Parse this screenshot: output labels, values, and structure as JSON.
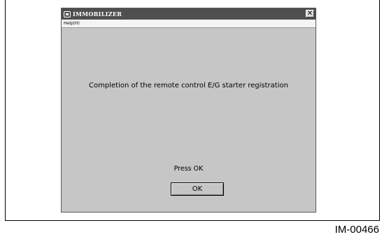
{
  "window": {
    "title": "IMMOBILIZER",
    "close_glyph": "✕",
    "menu": {
      "help_label": "Help(H)"
    }
  },
  "dialog": {
    "message": "Completion of the remote control E/G starter registration",
    "prompt": "Press OK",
    "ok_label": "OK"
  },
  "figure_id": "IM-00466",
  "icons": {
    "app": "app-window-icon",
    "close": "close-icon"
  },
  "colors": {
    "titlebar": "#4f4f4f",
    "window_background": "#c6c6c6",
    "menubar": "#f4f4f4"
  }
}
